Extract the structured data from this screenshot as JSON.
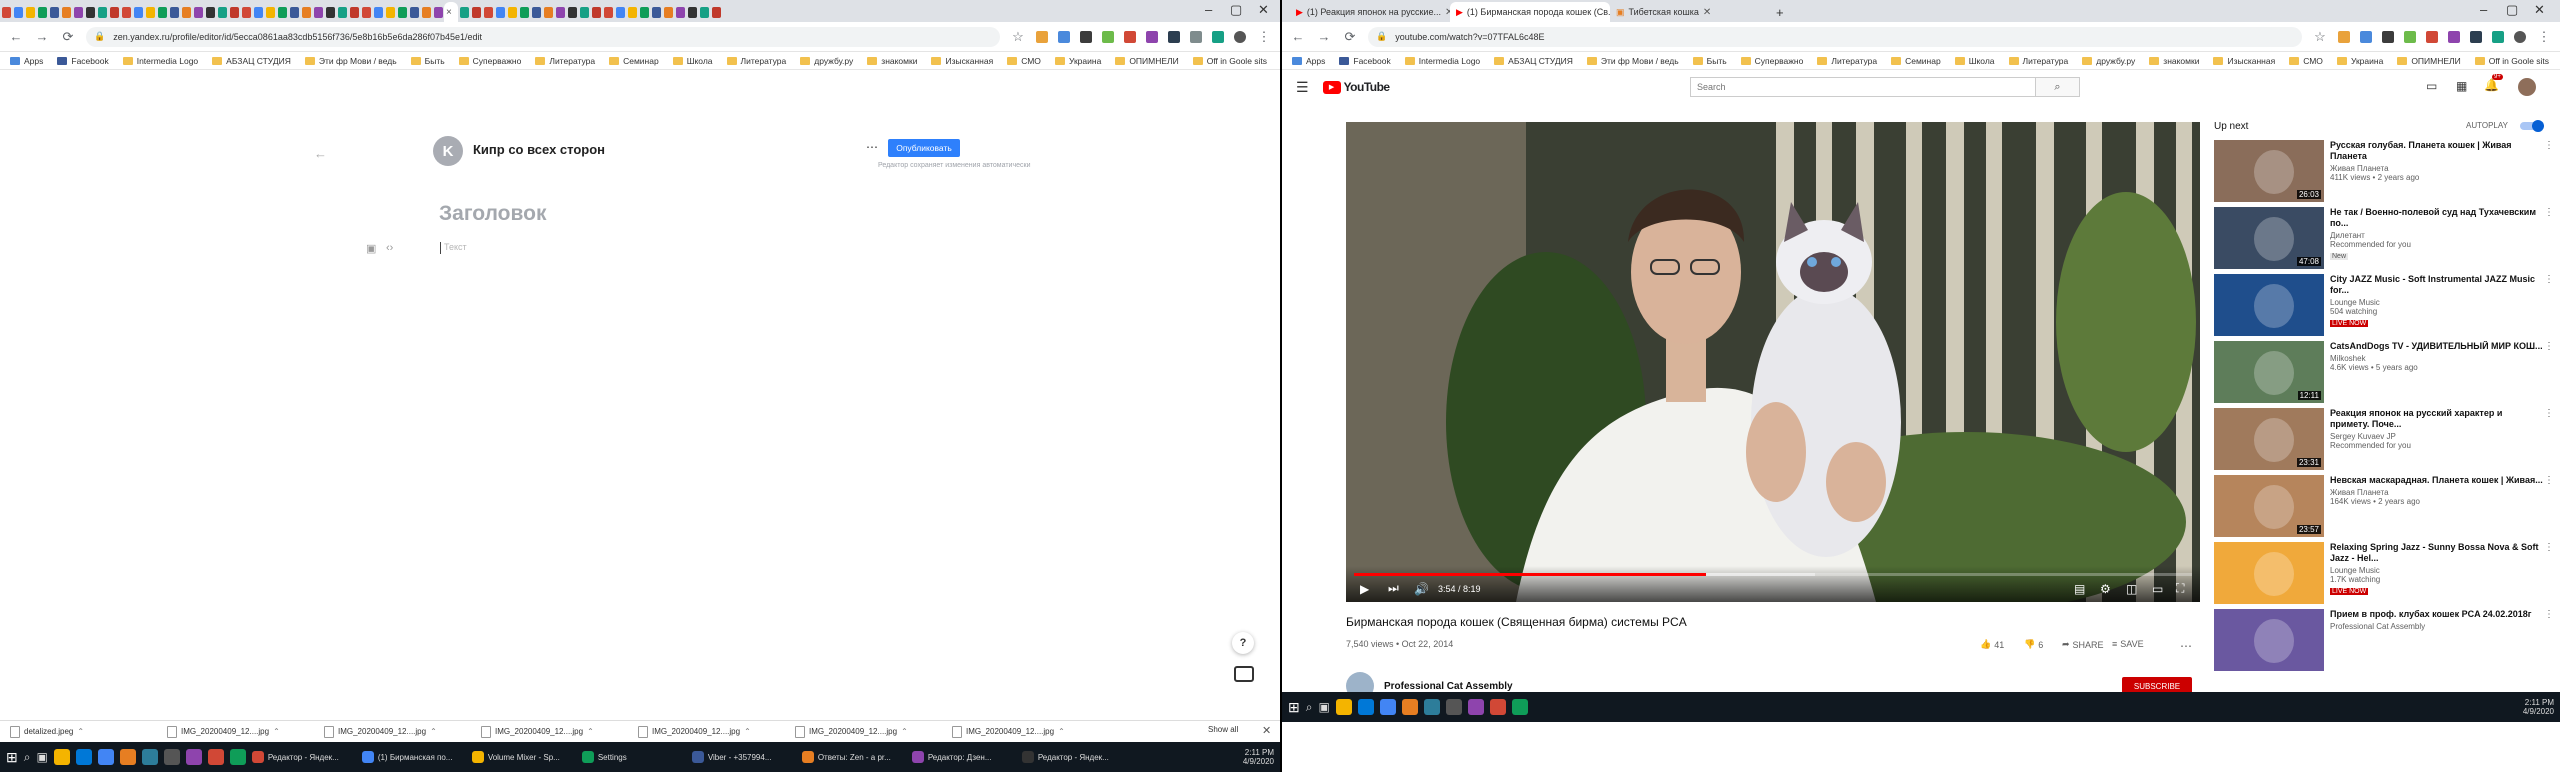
{
  "left_window": {
    "tabs_count": 60,
    "active_tab_close": "×",
    "window_controls": [
      "–",
      "▢",
      "✕"
    ],
    "url": "zen.yandex.ru/profile/editor/id/5ecca0861aa83cdb5156f736/5e8b16b5e6da286f07b45e1/edit",
    "bookmarks": [
      "Apps",
      "Facebook",
      "Intermedia Logo",
      "АБЗАЦ СТУДИЯ",
      "Эти фр Мови / ведь",
      "Быть",
      "Суперважно",
      "Литература",
      "Семинар",
      "Школа",
      "Литература",
      "дружбу.ру",
      "знакомки",
      "Изысканная",
      "СМО",
      "Украина",
      "ОПИМНЕЛИ",
      "Off in Goole sits"
    ],
    "channel_initial": "K",
    "channel_name": "Кипр со всех сторон",
    "more": "⋯",
    "publish_label": "Опубликовать",
    "publish_note": "Редактор сохраняет изменения автоматически",
    "headline_placeholder": "Заголовок",
    "body_placeholder": "Текст",
    "downloads": [
      "detalized.jpeg",
      "IMG_20200409_12....jpg",
      "IMG_20200409_12....jpg",
      "IMG_20200409_12....jpg",
      "IMG_20200409_12....jpg",
      "IMG_20200409_12....jpg",
      "IMG_20200409_12....jpg"
    ],
    "show_all": "Show all",
    "help": "?",
    "taskbar": [
      "Редактор - Яндек...",
      "(1) Бирманская по...",
      "Volume Mixer - Sp...",
      "Settings",
      "Viber - +357994...",
      "Ответы: Zen - a pr...",
      "Редактор: Дзен...",
      "Редактор - Яндек..."
    ],
    "clock": "2:11 PM",
    "date": "4/9/2020"
  },
  "right_window": {
    "tabs": [
      "(1) Реакция японок на русские...",
      "(1) Бирманская порода кошек (Св...",
      "Тибетская кошка"
    ],
    "new_tab": "+",
    "window_controls": [
      "–",
      "▢",
      "✕"
    ],
    "url": "youtube.com/watch?v=07TFAL6c48E",
    "bookmarks": [
      "Apps",
      "Facebook",
      "Intermedia Logo",
      "АБЗАЦ СТУДИЯ",
      "Эти фр Мови / ведь",
      "Быть",
      "Суперважно",
      "Литература",
      "Семинар",
      "Школа",
      "Литература",
      "дружбу.ру",
      "знакомки",
      "Изысканная",
      "СМО",
      "Украина",
      "ОПИМНЕЛИ",
      "Off in Goole sits"
    ],
    "logo": "YouTube",
    "search_placeholder": "Search",
    "notif_count": "9+",
    "time_display": "3:54 / 8:19",
    "progress": 0.42,
    "buffered": 0.55,
    "video_title": "Бирманская порода кошек (Священная бирма) системы PCA",
    "views": "7,540 views • Oct 22, 2014",
    "likes": "41",
    "dislikes": "6",
    "share": "SHARE",
    "save": "SAVE",
    "channel": "Professional Cat Assembly",
    "subscribe": "SUBSCRIBE",
    "up_next": "Up next",
    "autoplay": "AUTOPLAY",
    "related": [
      {
        "title": "Русская голубая. Планета кошек | Живая Планета",
        "channel": "Живая Планета",
        "views": "411K views • 2 years ago",
        "duration": "26:03",
        "badge": ""
      },
      {
        "title": "Не так / Военно-полевой суд над Тухачевским по...",
        "channel": "Дилетант",
        "views": "Recommended for you",
        "duration": "47:08",
        "badge": "New"
      },
      {
        "title": "City JAZZ Music - Soft Instrumental JAZZ Music for...",
        "channel": "Lounge Music",
        "views": "504 watching",
        "duration": "",
        "badge": "LIVE NOW"
      },
      {
        "title": "CatsAndDogs TV - УДИВИТЕЛЬНЫЙ МИР КОШ...",
        "channel": "Milkoshek",
        "views": "4.6K views • 5 years ago",
        "duration": "12:11",
        "badge": ""
      },
      {
        "title": "Реакция японок на русский характер и примету. Поче...",
        "channel": "Sergey Kuvaev JP",
        "views": "Recommended for you",
        "duration": "23:31",
        "badge": ""
      },
      {
        "title": "Невская маскарадная. Планета кошек | Живая...",
        "channel": "Живая Планета",
        "views": "164K views • 2 years ago",
        "duration": "23:57",
        "badge": ""
      },
      {
        "title": "Relaxing Spring Jazz - Sunny Bossa Nova & Soft Jazz - Hel...",
        "channel": "Lounge Music",
        "views": "1.7K watching",
        "duration": "",
        "badge": "LIVE NOW"
      },
      {
        "title": "Прием в проф. клубах кошек PCA 24.02.2018г",
        "channel": "Professional Cat Assembly",
        "views": "",
        "duration": "",
        "badge": ""
      }
    ],
    "clock": "2:11 PM",
    "date": "4/9/2020"
  },
  "colors": {
    "accent": "#2e80fc",
    "yt_red": "#ff0000",
    "taskbar": "#101820"
  }
}
